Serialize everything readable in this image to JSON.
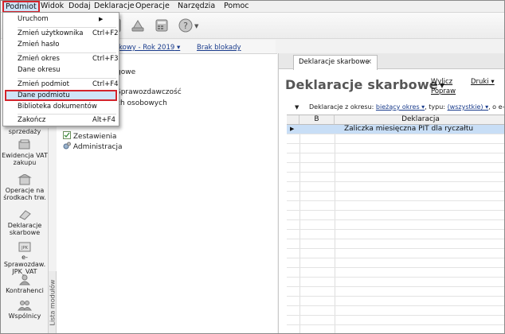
{
  "menubar": {
    "items": [
      "Podmiot",
      "Widok",
      "Dodaj",
      "Deklaracje",
      "Operacje",
      "Narzędzia",
      "Pomoc"
    ]
  },
  "status": {
    "period": "kowy - Rok 2019",
    "lock": "Brak blokady"
  },
  "dropdown": {
    "items": [
      {
        "label": "Uruchom",
        "shortcut": ""
      },
      {
        "label": "Zmień użytkownika",
        "shortcut": "Ctrl+F2"
      },
      {
        "label": "Zmień hasło",
        "shortcut": ""
      },
      {
        "label": "Zmień okres",
        "shortcut": "Ctrl+F3"
      },
      {
        "label": "Dane okresu",
        "shortcut": ""
      },
      {
        "label": "Zmień podmiot",
        "shortcut": "Ctrl+F4"
      },
      {
        "label": "Dane podmiotu",
        "shortcut": ""
      },
      {
        "label": "Biblioteka dokumentów",
        "shortcut": ""
      },
      {
        "label": "Zakończ",
        "shortcut": "Alt+F4"
      }
    ]
  },
  "tree": {
    "nodes": [
      "gowe",
      "Sprawozdawczość",
      "ch osobowych",
      "Zestawienia",
      "Administracja"
    ]
  },
  "modules": {
    "items": [
      {
        "label": "sprzedaży"
      },
      {
        "label": "Ewidencja VAT zakupu"
      },
      {
        "label": "Operacje na środkach trw."
      },
      {
        "label": "Deklaracje skarbowe"
      },
      {
        "label": "e-Sprawozdaw. JPK_VAT"
      },
      {
        "label": "Kontrahenci"
      },
      {
        "label": "Wspólnicy"
      }
    ],
    "tab_label": "Lista modułów"
  },
  "document": {
    "tab_label": "Deklaracje skarbowe",
    "title": "Deklaracje skarbowe",
    "actions": {
      "calculate": "Wylicz",
      "correct": "Popraw",
      "print": "Druki"
    },
    "filter": {
      "label": "Deklaracje z okresu:",
      "period_value": "bieżący okres",
      "type_label": ", typu:",
      "type_value": "(wszystkie)",
      "tail": ", o e-st"
    },
    "columns": [
      "B",
      "Deklaracja"
    ],
    "rows": [
      {
        "b": "",
        "name": "Zaliczka miesięczna PIT dla ryczałtu"
      }
    ]
  },
  "colors": {
    "highlight_border": "#d3242c",
    "selection": "#c8def6",
    "link": "#1a3c8c"
  }
}
